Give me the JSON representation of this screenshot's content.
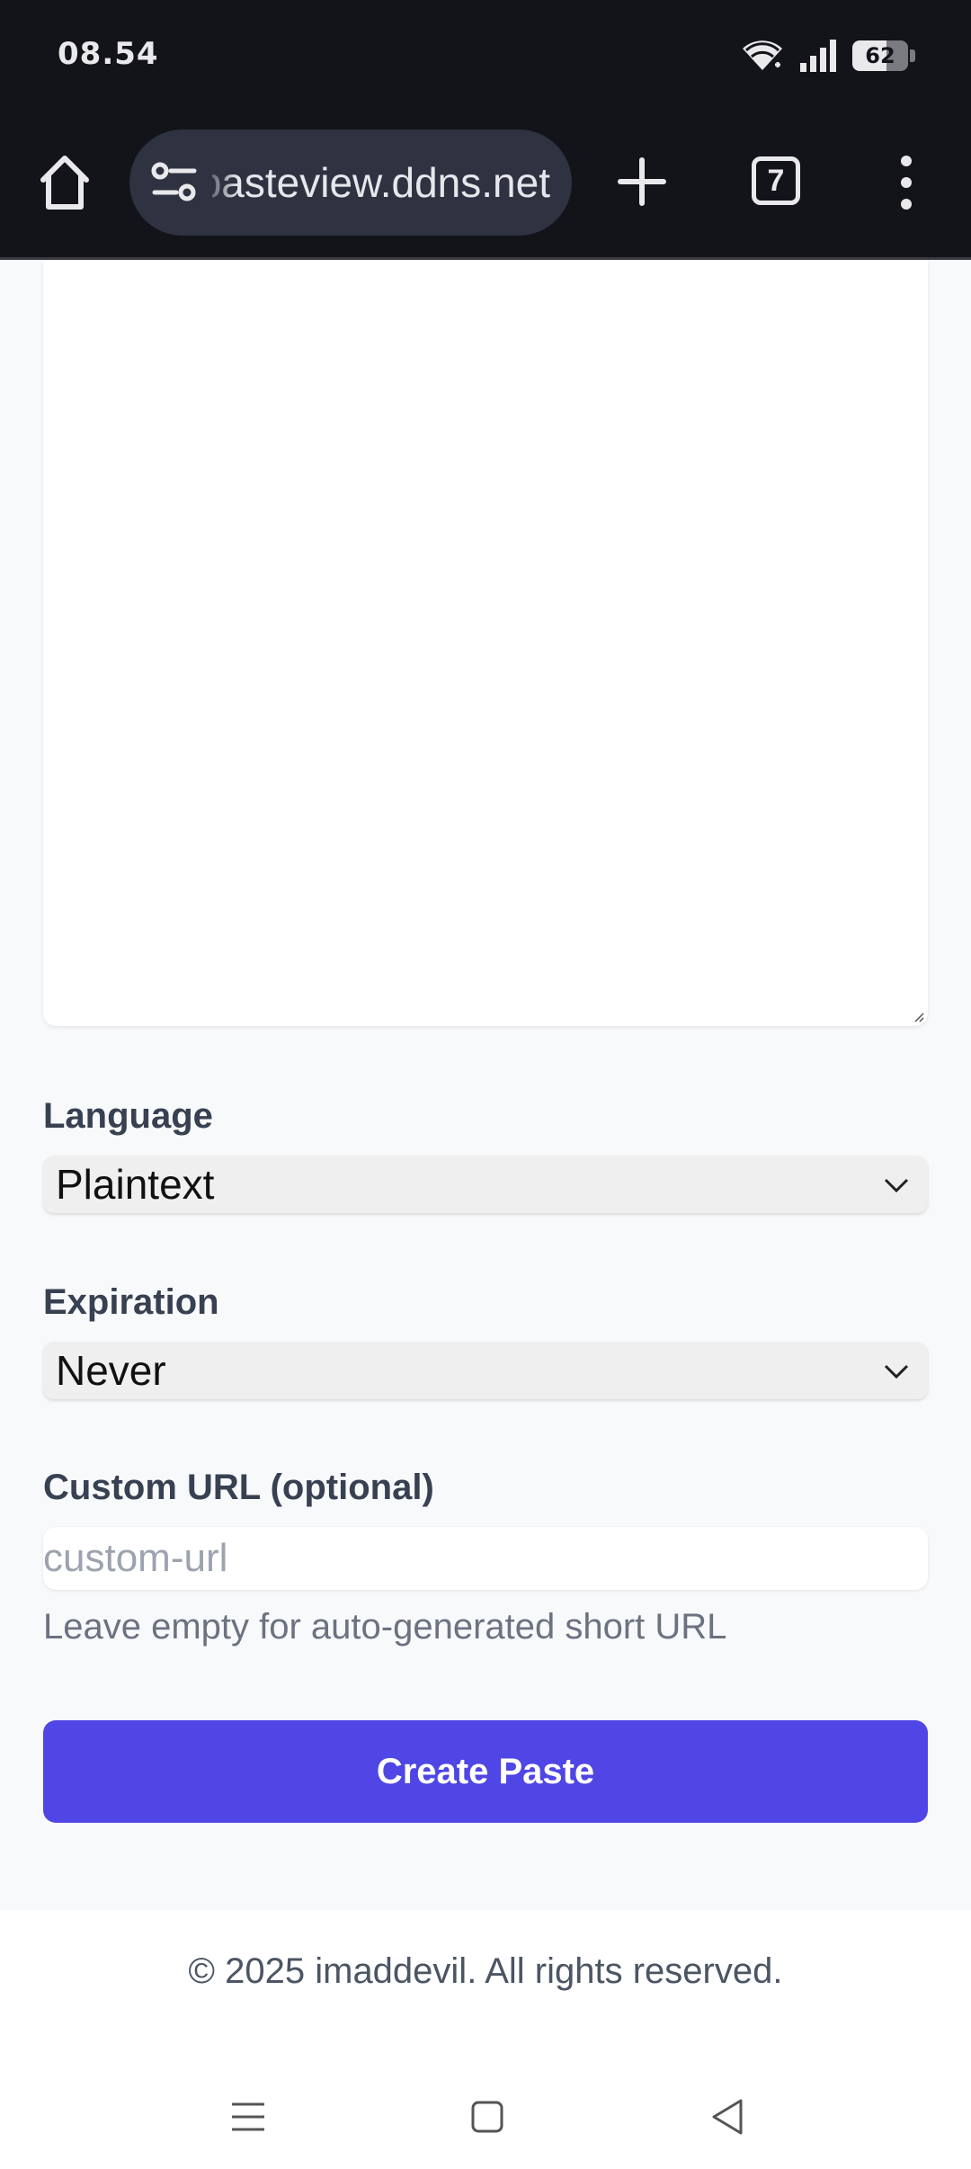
{
  "status_bar": {
    "time": "08.54",
    "battery": "62",
    "battery_level_percent": 62,
    "icons": [
      "wifi-icon",
      "signal-icon",
      "battery-icon"
    ]
  },
  "browser": {
    "url": "pasteview.ddns.net",
    "tab_count": "7",
    "icons": [
      "home-icon",
      "site-settings-icon",
      "new-tab-icon",
      "tab-switcher-icon",
      "more-menu-icon"
    ]
  },
  "form": {
    "language_label": "Language",
    "language_value": "Plaintext",
    "expiration_label": "Expiration",
    "expiration_value": "Never",
    "custom_url_label": "Custom URL (optional)",
    "custom_url_placeholder": "custom-url",
    "custom_url_hint": "Leave empty for auto-generated short URL",
    "submit_label": "Create Paste"
  },
  "footer": {
    "copyright": "© 2025 imaddevil. All rights reserved."
  },
  "nav_bar": {
    "icons": [
      "recents-icon",
      "home-nav-icon",
      "back-icon"
    ]
  },
  "colors": {
    "accent": "#4f46e5",
    "chrome_bg": "#13141a",
    "page_bg": "#f8f9fb"
  }
}
